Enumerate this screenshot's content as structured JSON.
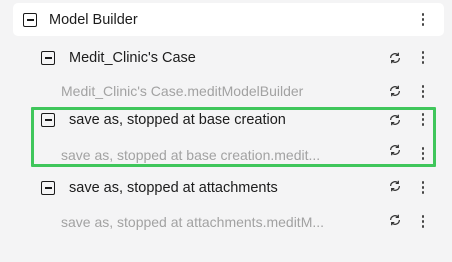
{
  "header": {
    "title": "Model Builder"
  },
  "tree": [
    {
      "label": "Medit_Clinic's Case",
      "sublabel": "Medit_Clinic's Case.meditModelBuilder"
    },
    {
      "label": "save as, stopped at base creation",
      "sublabel": "save as, stopped at base creation.medit..."
    },
    {
      "label": "save as, stopped at attachments",
      "sublabel": "save as, stopped at attachments.meditM..."
    }
  ],
  "highlight_color": "#3fc65b",
  "icons": {
    "toggle": "collapse-icon",
    "sync": "sync-icon",
    "menu": "more-vertical-icon"
  }
}
